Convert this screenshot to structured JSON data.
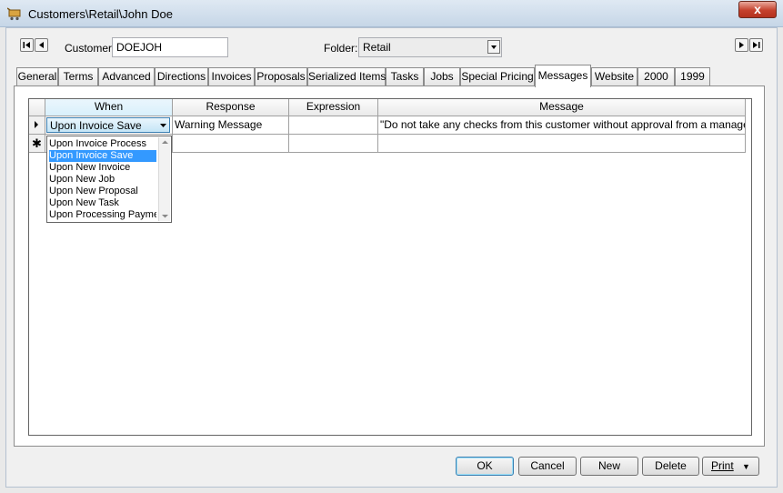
{
  "window": {
    "title": "Customers\\Retail\\John Doe",
    "close_label": "x",
    "icon": "cart-icon"
  },
  "header": {
    "customer_label": "Customer:",
    "customer_value": "DOEJOH",
    "folder_label": "Folder:",
    "folder_value": "Retail"
  },
  "tabs": [
    {
      "label": "General"
    },
    {
      "label": "Terms"
    },
    {
      "label": "Advanced"
    },
    {
      "label": "Directions"
    },
    {
      "label": "Invoices"
    },
    {
      "label": "Proposals"
    },
    {
      "label": "Serialized Items"
    },
    {
      "label": "Tasks"
    },
    {
      "label": "Jobs"
    },
    {
      "label": "Special Pricing"
    },
    {
      "label": "Messages",
      "active": true
    },
    {
      "label": "Website"
    },
    {
      "label": "2000"
    },
    {
      "label": "1999"
    }
  ],
  "grid": {
    "columns": [
      "When",
      "Response",
      "Expression",
      "Message"
    ],
    "rows": [
      {
        "when": "Upon Invoice Save",
        "response": "Warning Message",
        "expression": "",
        "message": "\"Do not take any checks from this customer without approval from a manager\""
      }
    ],
    "new_row_marker": "✱"
  },
  "when_dropdown": {
    "selected": "Upon Invoice Save",
    "options": [
      "Upon Invoice Process",
      "Upon Invoice Save",
      "Upon New Invoice",
      "Upon New Job",
      "Upon New Proposal",
      "Upon New Task",
      "Upon Processing Payme"
    ]
  },
  "buttons": {
    "ok": "OK",
    "cancel": "Cancel",
    "new": "New",
    "delete": "Delete",
    "print": "Print",
    "print_arrow": "▼"
  }
}
